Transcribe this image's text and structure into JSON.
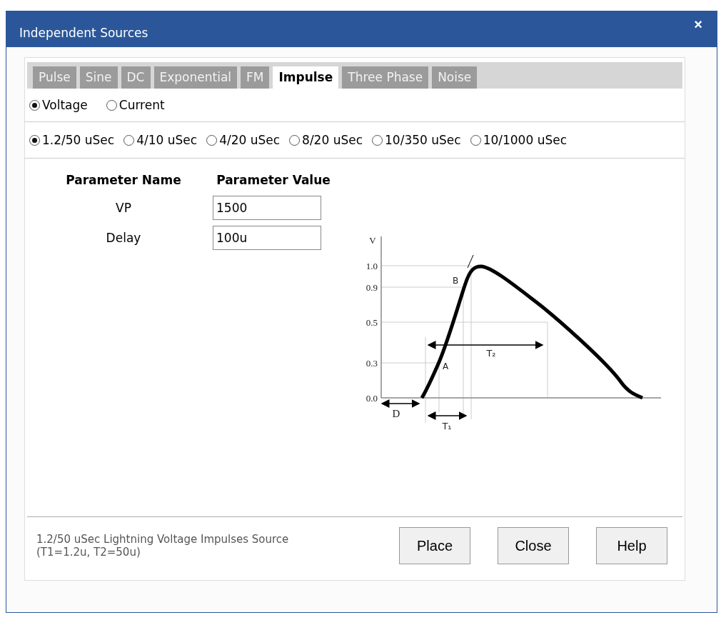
{
  "window": {
    "title": "Independent Sources",
    "close": "×"
  },
  "tabs": [
    {
      "label": "Pulse",
      "selected": false
    },
    {
      "label": "Sine",
      "selected": false
    },
    {
      "label": "DC",
      "selected": false
    },
    {
      "label": "Exponential",
      "selected": false
    },
    {
      "label": "FM",
      "selected": false
    },
    {
      "label": "Impulse",
      "selected": true
    },
    {
      "label": "Three Phase",
      "selected": false
    },
    {
      "label": "Noise",
      "selected": false
    }
  ],
  "source_type": [
    {
      "label": "Voltage",
      "selected": true
    },
    {
      "label": "Current",
      "selected": false
    }
  ],
  "waveform": [
    {
      "label": "1.2/50 uSec",
      "selected": true
    },
    {
      "label": "4/10 uSec",
      "selected": false
    },
    {
      "label": "4/20 uSec",
      "selected": false
    },
    {
      "label": "8/20 uSec",
      "selected": false
    },
    {
      "label": "10/350 uSec",
      "selected": false
    },
    {
      "label": "10/1000 uSec",
      "selected": false
    }
  ],
  "parameters": {
    "columns": [
      "Parameter Name",
      "Parameter Value"
    ],
    "rows": [
      {
        "name": "VP",
        "value": "1500"
      },
      {
        "name": "Delay",
        "value": "100u"
      }
    ]
  },
  "diagram": {
    "axis_label": "V",
    "y_labels": [
      "1.0",
      "0.9",
      "0.5",
      "0.3",
      "0.0"
    ],
    "point_a": "A",
    "point_b": "B",
    "delay": "D",
    "t1": "T₁",
    "t2": "T₂"
  },
  "description": [
    "1.2/50 uSec Lightning Voltage Impulses Source",
    "(T1=1.2u, T2=50u)"
  ],
  "buttons": [
    "Place",
    "Close",
    "Help"
  ]
}
